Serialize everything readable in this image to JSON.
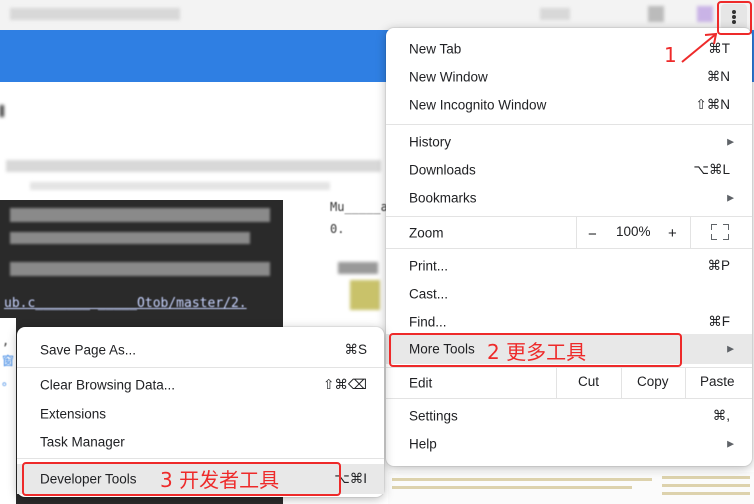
{
  "browser": {
    "menu_button_icon": "kebab-vertical-icon"
  },
  "main_menu": {
    "new_tab": {
      "label": "New Tab",
      "shortcut": "⌘T"
    },
    "new_window": {
      "label": "New Window",
      "shortcut": "⌘N"
    },
    "new_incognito": {
      "label": "New Incognito Window",
      "shortcut": "⇧⌘N"
    },
    "history": {
      "label": "History"
    },
    "downloads": {
      "label": "Downloads",
      "shortcut": "⌥⌘L"
    },
    "bookmarks": {
      "label": "Bookmarks"
    },
    "zoom": {
      "label": "Zoom",
      "minus": "−",
      "value": "100%",
      "plus": "+"
    },
    "print": {
      "label": "Print...",
      "shortcut": "⌘P"
    },
    "cast": {
      "label": "Cast..."
    },
    "find": {
      "label": "Find...",
      "shortcut": "⌘F"
    },
    "more_tools": {
      "label": "More Tools"
    },
    "edit": {
      "label": "Edit",
      "cut": "Cut",
      "copy": "Copy",
      "paste": "Paste"
    },
    "settings": {
      "label": "Settings",
      "shortcut": "⌘,"
    },
    "help": {
      "label": "Help"
    }
  },
  "sub_menu": {
    "save_page": {
      "label": "Save Page As...",
      "shortcut": "⌘S"
    },
    "clear_data": {
      "label": "Clear Browsing Data...",
      "shortcut": "⇧⌘⌫"
    },
    "extensions": {
      "label": "Extensions"
    },
    "task_manager": {
      "label": "Task Manager"
    },
    "developer_tools": {
      "label": "Developer Tools",
      "shortcut": "⌥⌘I"
    }
  },
  "annotations": {
    "step1": "1",
    "step2": "2 更多工具",
    "step3": "3 开发者工具",
    "color": "#ee2a2a"
  },
  "background": {
    "link_text": "ub.c_______ _____Otob/master/2.",
    "side_text_1": "Mu_____att",
    "side_text_2": "0.",
    "glyph_1": ",",
    "glyph_2": "窗",
    "glyph_3": "。"
  }
}
